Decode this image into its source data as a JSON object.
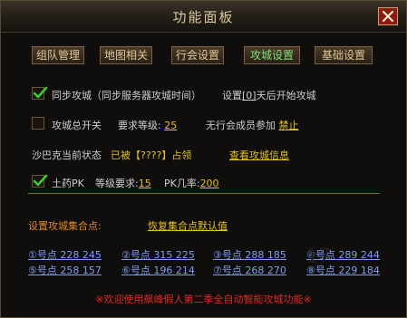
{
  "window": {
    "title": "功能面板",
    "close_symbol": "✕"
  },
  "tabs": [
    {
      "label": "组队管理",
      "active": false
    },
    {
      "label": "地图相关",
      "active": false
    },
    {
      "label": "行会设置",
      "active": false
    },
    {
      "label": "攻城设置",
      "active": true
    },
    {
      "label": "基础设置",
      "active": false
    }
  ],
  "sync": {
    "checked": true,
    "label": "同步攻城",
    "hint": "（同步服务器攻城时间）",
    "setting_prefix": "设置",
    "days_value": "[0]",
    "setting_suffix": "天后开始攻城"
  },
  "total_switch": {
    "checked": false,
    "label": "攻城总开关",
    "req_label": "要求等级:",
    "req_value": "25",
    "no_guild_label": "无行会成员参加",
    "no_guild_value": "禁止"
  },
  "sabak": {
    "label": "沙巴克当前状态",
    "status_prefix": "已被",
    "status_owner": "【????】",
    "status_suffix": "占领",
    "view_link": "查看攻城信息"
  },
  "pk": {
    "checked": true,
    "label": "土药PK",
    "level_label": "等级要求:",
    "level_value": "15",
    "rate_label": "PK几率:",
    "rate_value": "200"
  },
  "gather": {
    "label": "设置攻城集合点:",
    "reset_link": "恢复集合点默认值",
    "points": [
      {
        "label": "①号点",
        "coords": "228 245"
      },
      {
        "label": "②号点",
        "coords": "315 225"
      },
      {
        "label": "③号点",
        "coords": "288 185"
      },
      {
        "label": "④号点",
        "coords": "289 244"
      },
      {
        "label": "⑤号点",
        "coords": "258 157"
      },
      {
        "label": "⑥号点",
        "coords": "196 214"
      },
      {
        "label": "⑦号点",
        "coords": "268 270"
      },
      {
        "label": "⑧号点",
        "coords": "229 184"
      }
    ]
  },
  "footer": "※欢迎使用飙峰假人第二季全自动智能攻城功能※",
  "watermark": "17",
  "colors": {
    "label": "#cfcfcf",
    "value_yellow": "#e6c21c",
    "value_orange": "#e08a24",
    "accent_green": "#7ee07a",
    "link_blue": "#7e9ff0",
    "footer_red": "#e02a2a"
  }
}
